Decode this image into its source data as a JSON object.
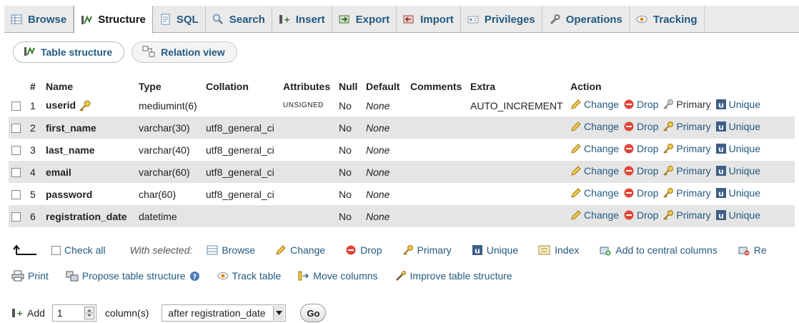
{
  "tabs": [
    {
      "label": "Browse",
      "icon": "browse-icon",
      "active": false
    },
    {
      "label": "Structure",
      "icon": "structure-icon",
      "active": true
    },
    {
      "label": "SQL",
      "icon": "sql-icon",
      "active": false
    },
    {
      "label": "Search",
      "icon": "search-icon",
      "active": false
    },
    {
      "label": "Insert",
      "icon": "insert-icon",
      "active": false
    },
    {
      "label": "Export",
      "icon": "export-icon",
      "active": false
    },
    {
      "label": "Import",
      "icon": "import-icon",
      "active": false
    },
    {
      "label": "Privileges",
      "icon": "privileges-icon",
      "active": false
    },
    {
      "label": "Operations",
      "icon": "wrench-icon",
      "active": false
    },
    {
      "label": "Tracking",
      "icon": "eye-icon",
      "active": false
    }
  ],
  "subtabs": {
    "table_structure": "Table structure",
    "relation_view": "Relation view"
  },
  "table": {
    "headers": {
      "num": "#",
      "name": "Name",
      "type": "Type",
      "collation": "Collation",
      "attributes": "Attributes",
      "null": "Null",
      "default": "Default",
      "comments": "Comments",
      "extra": "Extra",
      "action": "Action"
    },
    "rows": [
      {
        "num": "1",
        "name": "userid",
        "type": "mediumint(6)",
        "collation": "",
        "attributes": "UNSIGNED",
        "null": "No",
        "default": "None",
        "comments": "",
        "extra": "AUTO_INCREMENT"
      },
      {
        "num": "2",
        "name": "first_name",
        "type": "varchar(30)",
        "collation": "utf8_general_ci",
        "attributes": "",
        "null": "No",
        "default": "None",
        "comments": "",
        "extra": ""
      },
      {
        "num": "3",
        "name": "last_name",
        "type": "varchar(40)",
        "collation": "utf8_general_ci",
        "attributes": "",
        "null": "No",
        "default": "None",
        "comments": "",
        "extra": ""
      },
      {
        "num": "4",
        "name": "email",
        "type": "varchar(60)",
        "collation": "utf8_general_ci",
        "attributes": "",
        "null": "No",
        "default": "None",
        "comments": "",
        "extra": ""
      },
      {
        "num": "5",
        "name": "password",
        "type": "char(60)",
        "collation": "utf8_general_ci",
        "attributes": "",
        "null": "No",
        "default": "None",
        "comments": "",
        "extra": ""
      },
      {
        "num": "6",
        "name": "registration_date",
        "type": "datetime",
        "collation": "",
        "attributes": "",
        "null": "No",
        "default": "None",
        "comments": "",
        "extra": ""
      }
    ],
    "actions": {
      "change": "Change",
      "drop": "Drop",
      "primary": "Primary",
      "unique": "Unique"
    }
  },
  "with_selected": {
    "check_all": "Check all",
    "label": "With selected:",
    "browse": "Browse",
    "change": "Change",
    "drop": "Drop",
    "primary": "Primary",
    "unique": "Unique",
    "index": "Index",
    "add_central": "Add to central columns",
    "remove_central": "Re"
  },
  "links": {
    "print": "Print",
    "propose": "Propose table structure",
    "track": "Track table",
    "move": "Move columns",
    "improve": "Improve table structure"
  },
  "add_columns": {
    "add_label": "Add",
    "count": "1",
    "columns_label": "column(s)",
    "position": "after registration_date",
    "go": "Go"
  },
  "colors": {
    "link": "#235a81",
    "row_alt": "#e5e5e5",
    "tabbar": "#eaeaea"
  }
}
